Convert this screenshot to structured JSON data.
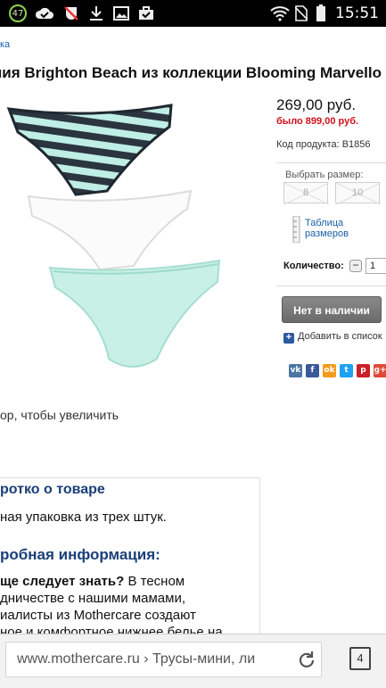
{
  "status_bar": {
    "badge": "47",
    "time": "15:51"
  },
  "page": {
    "breadcrumb": "ка",
    "title": "ния Brighton Beach из коллекции Blooming Marvello",
    "zoom_hint": "ор, чтобы увеличить"
  },
  "product": {
    "price": "269,00 руб.",
    "old_price": "было 899,00 руб.",
    "code": "Код продукта: B1856",
    "size_label": "Выбрать размер:",
    "sizes": [
      "8",
      "10"
    ],
    "size_table_label": "Таблица размеров",
    "quantity_label": "Количество:",
    "quantity_value": "1",
    "quantity_minus": "−",
    "stock_button": "Нет в наличии",
    "wishlist": "Добавить в список",
    "share_icons": [
      "vk",
      "facebook",
      "odnoklassniki",
      "twitter",
      "pinterest",
      "google-plus"
    ]
  },
  "info": {
    "brief_title": "ротко о товаре",
    "brief_text": "ная упаковка из трех штук.",
    "detail_title": "робная информация:",
    "detail_lines": [
      {
        "bold": "ще следует знать?",
        "rest": " В тесном"
      },
      {
        "bold": "",
        "rest": "дничестве с нашими мамами,"
      },
      {
        "bold": "",
        "rest": "иалисты из Mothercare создают"
      },
      {
        "bold": "",
        "rest": "ное и комфортное нижнее белье на"
      }
    ]
  },
  "browser": {
    "url": "www.mothercare.ru › Трусы-мини, ли",
    "tab_count": "4"
  }
}
